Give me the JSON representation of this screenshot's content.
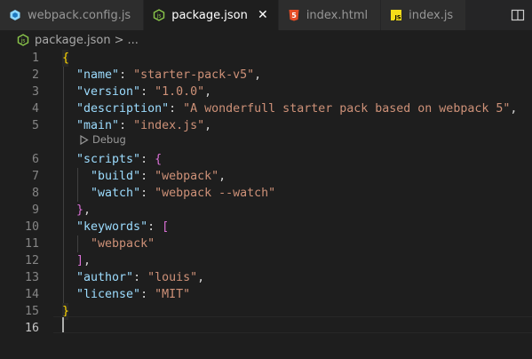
{
  "tabs": [
    {
      "label": "webpack.config.js",
      "icon": "webpack-icon",
      "active": false
    },
    {
      "label": "package.json",
      "icon": "node-json-icon",
      "active": true,
      "close": "✕"
    },
    {
      "label": "index.html",
      "icon": "html5-icon",
      "active": false
    },
    {
      "label": "index.js",
      "icon": "js-icon",
      "active": false
    }
  ],
  "breadcrumb": {
    "file": "package.json",
    "separator": ">",
    "more": "..."
  },
  "codelens": {
    "label": "Debug"
  },
  "editor": {
    "current_line": 16,
    "lines": [
      {
        "n": "1",
        "tokens": [
          {
            "c": "p",
            "t": "{"
          }
        ]
      },
      {
        "n": "2",
        "tokens": [
          {
            "c": "t",
            "t": "  "
          },
          {
            "c": "k",
            "t": "\"name\""
          },
          {
            "c": "t",
            "t": ": "
          },
          {
            "c": "s",
            "t": "\"starter-pack-v5\""
          },
          {
            "c": "t",
            "t": ","
          }
        ]
      },
      {
        "n": "3",
        "tokens": [
          {
            "c": "t",
            "t": "  "
          },
          {
            "c": "k",
            "t": "\"version\""
          },
          {
            "c": "t",
            "t": ": "
          },
          {
            "c": "s",
            "t": "\"1.0.0\""
          },
          {
            "c": "t",
            "t": ","
          }
        ]
      },
      {
        "n": "4",
        "tokens": [
          {
            "c": "t",
            "t": "  "
          },
          {
            "c": "k",
            "t": "\"description\""
          },
          {
            "c": "t",
            "t": ": "
          },
          {
            "c": "s",
            "t": "\"A wonderfull starter pack based on webpack 5\""
          },
          {
            "c": "t",
            "t": ","
          }
        ]
      },
      {
        "n": "5",
        "tokens": [
          {
            "c": "t",
            "t": "  "
          },
          {
            "c": "k",
            "t": "\"main\""
          },
          {
            "c": "t",
            "t": ": "
          },
          {
            "c": "s",
            "t": "\"index.js\""
          },
          {
            "c": "t",
            "t": ","
          }
        ]
      },
      {
        "n": "6",
        "tokens": [
          {
            "c": "t",
            "t": "  "
          },
          {
            "c": "k",
            "t": "\"scripts\""
          },
          {
            "c": "t",
            "t": ": "
          },
          {
            "c": "p2",
            "t": "{"
          }
        ]
      },
      {
        "n": "7",
        "tokens": [
          {
            "c": "t",
            "t": "    "
          },
          {
            "c": "k",
            "t": "\"build\""
          },
          {
            "c": "t",
            "t": ": "
          },
          {
            "c": "s",
            "t": "\"webpack\""
          },
          {
            "c": "t",
            "t": ","
          }
        ]
      },
      {
        "n": "8",
        "tokens": [
          {
            "c": "t",
            "t": "    "
          },
          {
            "c": "k",
            "t": "\"watch\""
          },
          {
            "c": "t",
            "t": ": "
          },
          {
            "c": "s",
            "t": "\"webpack --watch\""
          }
        ]
      },
      {
        "n": "9",
        "tokens": [
          {
            "c": "t",
            "t": "  "
          },
          {
            "c": "p2",
            "t": "}"
          },
          {
            "c": "t",
            "t": ","
          }
        ]
      },
      {
        "n": "10",
        "tokens": [
          {
            "c": "t",
            "t": "  "
          },
          {
            "c": "k",
            "t": "\"keywords\""
          },
          {
            "c": "t",
            "t": ": "
          },
          {
            "c": "p2",
            "t": "["
          }
        ]
      },
      {
        "n": "11",
        "tokens": [
          {
            "c": "t",
            "t": "    "
          },
          {
            "c": "s",
            "t": "\"webpack\""
          }
        ]
      },
      {
        "n": "12",
        "tokens": [
          {
            "c": "t",
            "t": "  "
          },
          {
            "c": "p2",
            "t": "]"
          },
          {
            "c": "t",
            "t": ","
          }
        ]
      },
      {
        "n": "13",
        "tokens": [
          {
            "c": "t",
            "t": "  "
          },
          {
            "c": "k",
            "t": "\"author\""
          },
          {
            "c": "t",
            "t": ": "
          },
          {
            "c": "s",
            "t": "\"louis\""
          },
          {
            "c": "t",
            "t": ","
          }
        ]
      },
      {
        "n": "14",
        "tokens": [
          {
            "c": "t",
            "t": "  "
          },
          {
            "c": "k",
            "t": "\"license\""
          },
          {
            "c": "t",
            "t": ": "
          },
          {
            "c": "s",
            "t": "\"MIT\""
          }
        ]
      },
      {
        "n": "15",
        "tokens": [
          {
            "c": "p",
            "t": "}"
          }
        ]
      },
      {
        "n": "16",
        "tokens": []
      }
    ]
  },
  "colors": {
    "editor_bg": "#1e1e1e",
    "tab_inactive_bg": "#2d2d2d",
    "key": "#9cdcfe",
    "string": "#ce9178",
    "bracket_level1": "#ffd700",
    "bracket_level2": "#da70d6",
    "line_number": "#858585"
  }
}
